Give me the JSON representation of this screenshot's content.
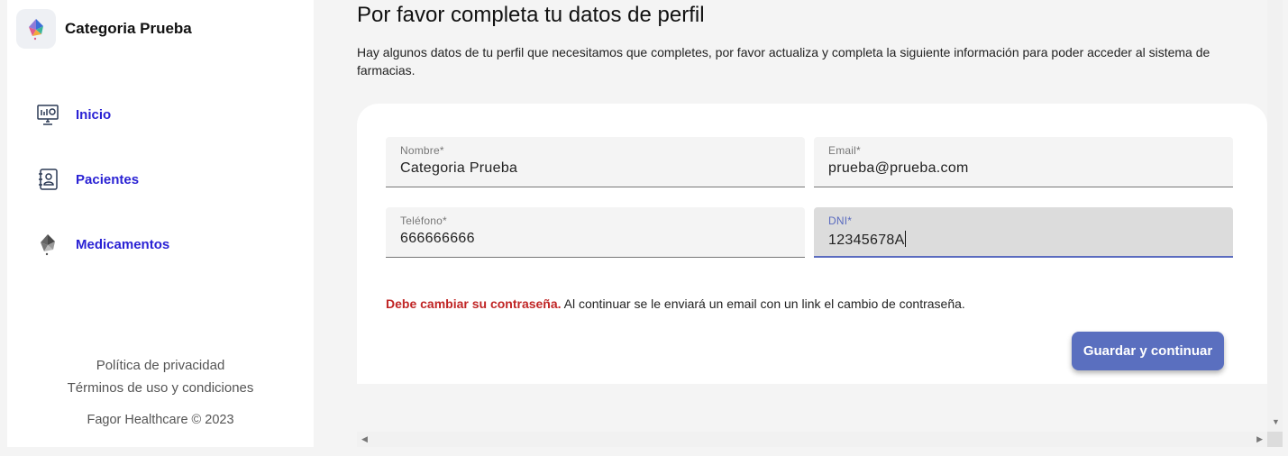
{
  "app": {
    "name": "Categoria Prueba",
    "logo_icon": "brand-logo-icon"
  },
  "sidebar": {
    "items": [
      {
        "label": "Inicio",
        "icon": "dashboard-monitor-icon"
      },
      {
        "label": "Pacientes",
        "icon": "patients-contact-book-icon"
      },
      {
        "label": "Medicamentos",
        "icon": "medicines-icon"
      }
    ],
    "footer": {
      "privacy": "Política de privacidad",
      "terms": "Términos de uso y condiciones",
      "copyright": "Fagor Healthcare © 2023"
    }
  },
  "main": {
    "title": "Por favor completa tu datos de perfil",
    "description": "Hay algunos datos de tu perfil que necesitamos que completes, por favor actualiza y completa la siguiente información para poder acceder al sistema de farmacias.",
    "form": {
      "nombre": {
        "label": "Nombre*",
        "value": "Categoria Prueba"
      },
      "email": {
        "label": "Email*",
        "value": "prueba@prueba.com"
      },
      "telefono": {
        "label": "Teléfono*",
        "value": "666666666"
      },
      "dni": {
        "label": "DNI*",
        "value": "12345678A"
      }
    },
    "notice": {
      "strong": "Debe cambiar su contraseña.",
      "text": " Al continuar se le enviará un email con un link el cambio de contraseña."
    },
    "save_label": "Guardar y continuar"
  },
  "colors": {
    "accent": "#5a6fbf",
    "nav_link": "#2a22d4",
    "warning": "#c02525"
  }
}
